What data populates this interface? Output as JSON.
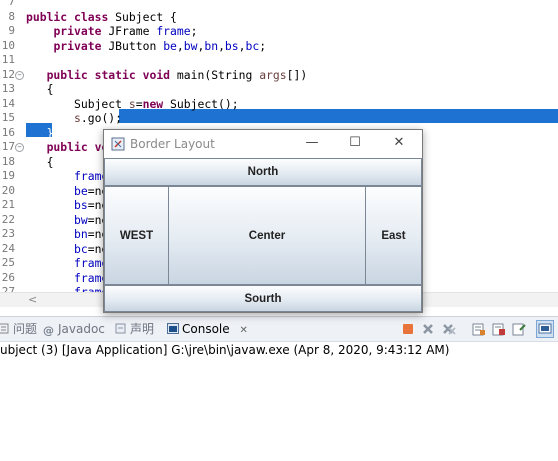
{
  "editor": {
    "lines": [
      {
        "num": "7",
        "fold": false,
        "segs": []
      },
      {
        "num": "8",
        "fold": false,
        "segs": [
          [
            "kw",
            "public "
          ],
          [
            "kw",
            "class "
          ],
          [
            "",
            "Subject {"
          ]
        ]
      },
      {
        "num": "9",
        "fold": false,
        "segs": [
          [
            "",
            "    "
          ],
          [
            "kw",
            "private "
          ],
          [
            "",
            "JFrame "
          ],
          [
            "fld",
            "frame"
          ],
          [
            "",
            ";"
          ]
        ]
      },
      {
        "num": "10",
        "fold": false,
        "segs": [
          [
            "",
            "    "
          ],
          [
            "kw",
            "private "
          ],
          [
            "",
            "JButton "
          ],
          [
            "fld",
            "be"
          ],
          [
            "",
            ","
          ],
          [
            "fld",
            "bw"
          ],
          [
            "",
            ","
          ],
          [
            "fld",
            "bn"
          ],
          [
            "",
            ","
          ],
          [
            "fld",
            "bs"
          ],
          [
            "",
            ","
          ],
          [
            "fld",
            "bc"
          ],
          [
            "",
            ";"
          ]
        ]
      },
      {
        "num": "11",
        "fold": false,
        "segs": []
      },
      {
        "num": "12",
        "fold": true,
        "segs": [
          [
            "",
            "   "
          ],
          [
            "kw",
            "public "
          ],
          [
            "kw",
            "static "
          ],
          [
            "kw",
            "void "
          ],
          [
            "",
            "main(String "
          ],
          [
            "par",
            "args"
          ],
          [
            "",
            "[])"
          ]
        ]
      },
      {
        "num": "13",
        "fold": false,
        "segs": [
          [
            "",
            "   {"
          ]
        ]
      },
      {
        "num": "14",
        "fold": false,
        "segs": [
          [
            "",
            "       Subject "
          ],
          [
            "par",
            "s"
          ],
          [
            "",
            "="
          ],
          [
            "kw",
            "new "
          ],
          [
            "",
            "Subject();"
          ]
        ]
      },
      {
        "num": "15",
        "fold": false,
        "segs": [
          [
            "",
            "       "
          ],
          [
            "par",
            "s"
          ],
          [
            "",
            ".go();"
          ]
        ]
      },
      {
        "num": "16",
        "fold": false,
        "segs": [
          [
            "",
            "   }"
          ]
        ]
      },
      {
        "num": "17",
        "fold": true,
        "segs": [
          [
            "",
            "   "
          ],
          [
            "kw",
            "public "
          ],
          [
            "kw",
            "vo"
          ]
        ]
      },
      {
        "num": "18",
        "fold": false,
        "segs": [
          [
            "",
            "   {"
          ]
        ]
      },
      {
        "num": "19",
        "fold": false,
        "segs": [
          [
            "",
            "       "
          ],
          [
            "fld",
            "frame"
          ]
        ]
      },
      {
        "num": "20",
        "fold": false,
        "segs": [
          [
            "",
            "       "
          ],
          [
            "fld",
            "be"
          ],
          [
            "",
            "=ne"
          ]
        ]
      },
      {
        "num": "21",
        "fold": false,
        "segs": [
          [
            "",
            "       "
          ],
          [
            "fld",
            "bs"
          ],
          [
            "",
            "=ne"
          ]
        ]
      },
      {
        "num": "22",
        "fold": false,
        "segs": [
          [
            "",
            "       "
          ],
          [
            "fld",
            "bw"
          ],
          [
            "",
            "=ne"
          ]
        ]
      },
      {
        "num": "23",
        "fold": false,
        "segs": [
          [
            "",
            "       "
          ],
          [
            "fld",
            "bn"
          ],
          [
            "",
            "=ne"
          ]
        ]
      },
      {
        "num": "24",
        "fold": false,
        "segs": [
          [
            "",
            "       "
          ],
          [
            "fld",
            "bc"
          ],
          [
            "",
            "=ne"
          ]
        ]
      },
      {
        "num": "25",
        "fold": false,
        "segs": [
          [
            "",
            "       "
          ],
          [
            "fld",
            "frame"
          ]
        ]
      },
      {
        "num": "26",
        "fold": false,
        "segs": [
          [
            "",
            "       "
          ],
          [
            "fld",
            "frame"
          ]
        ]
      },
      {
        "num": "27",
        "fold": false,
        "segs": [
          [
            "",
            "       "
          ],
          [
            "fld",
            "frame"
          ]
        ]
      }
    ],
    "scroll_left_glyph": "<"
  },
  "views": {
    "tabs": [
      {
        "label": "问题",
        "icon": "problems-icon",
        "active": false
      },
      {
        "label": "Javadoc",
        "icon": "javadoc-icon",
        "active": false
      },
      {
        "label": "声明",
        "icon": "declaration-icon",
        "active": false
      },
      {
        "label": "Console",
        "icon": "console-icon",
        "active": true
      }
    ],
    "close_glyph": "✕"
  },
  "console": {
    "status": "ubject (3) [Java Application] G:\\jre\\bin\\javaw.exe (Apr 8, 2020, 9:43:12 AM)"
  },
  "window": {
    "title": "Border Layout",
    "minimize": "—",
    "maximize": "☐",
    "close": "✕",
    "buttons": {
      "north": "North",
      "west": "WEST",
      "center": "Center",
      "east": "East",
      "south": "Sourth"
    }
  },
  "colors": {
    "keyword": "#7f0055",
    "field": "#0000c0",
    "selection": "#1e73d2"
  }
}
